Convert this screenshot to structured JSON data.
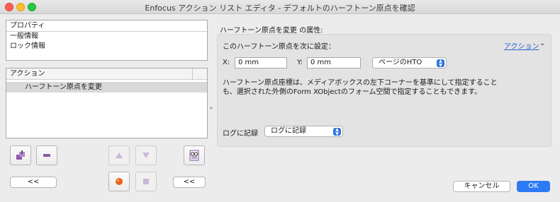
{
  "window": {
    "title": "Enfocus アクション リスト エディタ - デフォルトのハーフトーン原点を確認"
  },
  "properties": {
    "header": "プロパティ",
    "items": [
      {
        "label": "一般情報"
      },
      {
        "label": "ロック情報"
      }
    ]
  },
  "actions": {
    "header": "アクション",
    "items": [
      {
        "label": "ハーフトーン原点を変更",
        "selected": true
      }
    ]
  },
  "toolbar": {
    "left_collapse_label": "<<",
    "right_collapse_label": "<<",
    "icons": [
      "add-action-icon",
      "remove-action-icon",
      "move-up-icon",
      "move-down-icon",
      "preview-icon",
      "record-icon",
      "stop-icon"
    ]
  },
  "attributes": {
    "title": "ハーフトーン原点を変更 の属性:",
    "set_label": "このハーフトーン原点を次に設定：",
    "action_menu": "アクション",
    "x_label": "X:",
    "x_value": "0 mm",
    "y_label": "Y:",
    "y_value": "0 mm",
    "origin_select": "ページのHTO",
    "description": "ハーフトーン原点座標は、メディアボックスの左下コーナーを基準にして指定することも、選択された外側のForm XObjectのフォーム空間で指定することもできます。",
    "log_label": "ログに記録",
    "log_select": "ログに記録"
  },
  "buttons": {
    "cancel": "キャンセル",
    "ok": "OK"
  },
  "colors": {
    "accent": "#2d7bf4",
    "link": "#2a64d6",
    "icon_purple": "#8a5aa6",
    "record_orange": "#e8631a"
  }
}
